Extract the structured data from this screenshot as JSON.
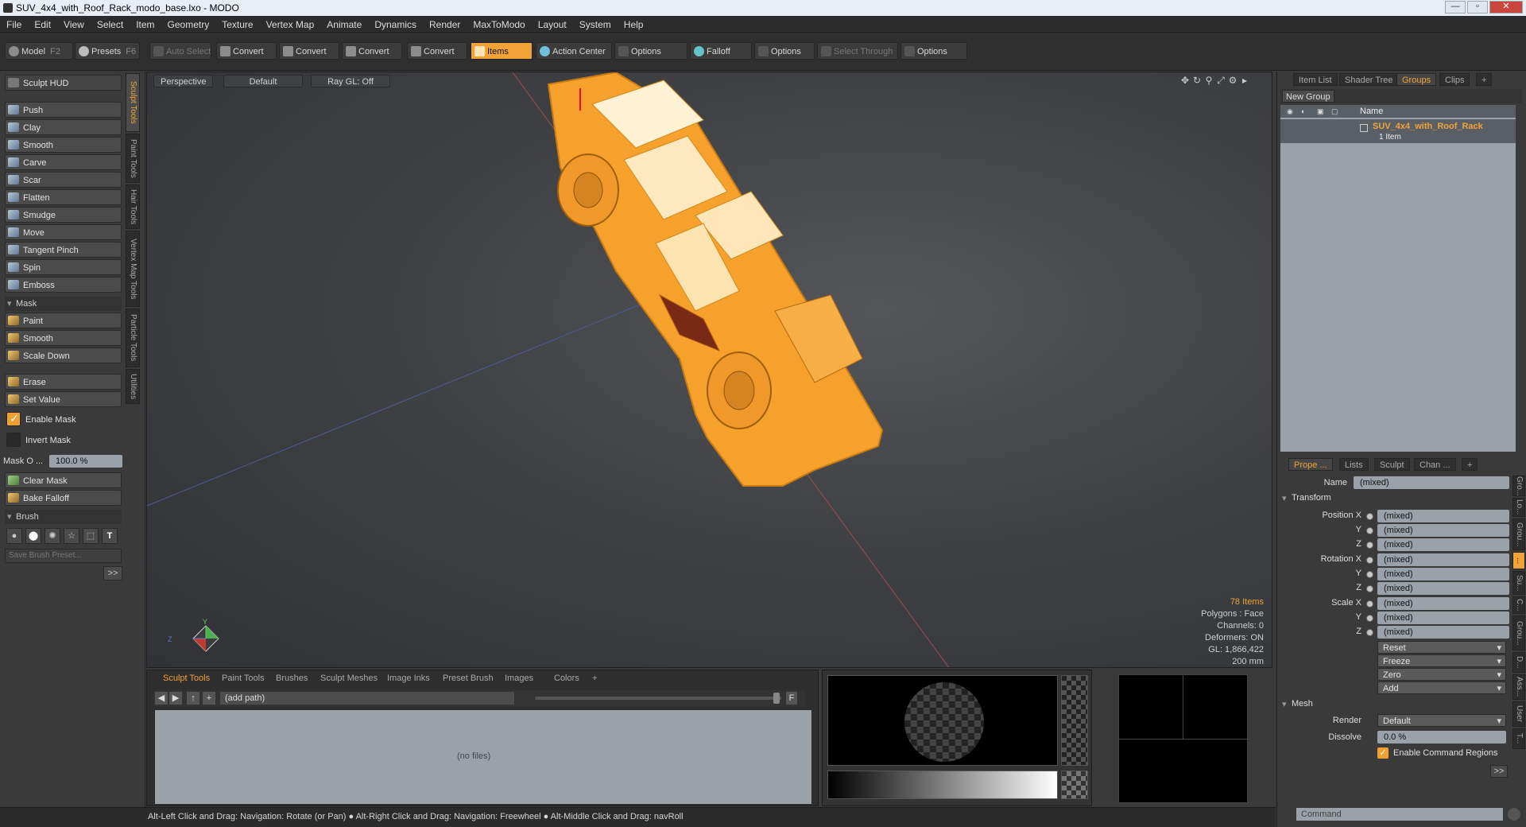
{
  "window": {
    "title": "SUV_4x4_with_Roof_Rack_modo_base.lxo - MODO",
    "min": "—",
    "max": "▫",
    "close": "✕"
  },
  "menu": [
    "File",
    "Edit",
    "View",
    "Select",
    "Item",
    "Geometry",
    "Texture",
    "Vertex Map",
    "Animate",
    "Dynamics",
    "Render",
    "MaxToModo",
    "Layout",
    "System",
    "Help"
  ],
  "toolbar": {
    "model": "Model",
    "model_key": "F2",
    "presets": "Presets",
    "presets_key": "F6",
    "auto_select": "Auto Select",
    "convert1": "Convert",
    "convert2": "Convert",
    "convert3": "Convert",
    "convert4": "Convert",
    "items": "Items",
    "action_center": "Action Center",
    "options1": "Options",
    "falloff": "Falloff",
    "options2": "Options",
    "select_through": "Select Through",
    "options3": "Options"
  },
  "left": {
    "hud": "Sculpt HUD",
    "tools": [
      "Push",
      "Clay",
      "Smooth",
      "Carve",
      "Scar",
      "Flatten",
      "Smudge",
      "Move",
      "Tangent Pinch",
      "Spin",
      "Emboss"
    ],
    "mask_section": "Mask",
    "mask_tools": [
      "Paint",
      "Smooth",
      "Scale Down"
    ],
    "erase": "Erase",
    "set_value": "Set Value",
    "enable_mask": "Enable Mask",
    "invert_mask": "Invert Mask",
    "mask_opacity_label": "Mask O ...",
    "mask_opacity_value": "100.0 %",
    "clear_mask": "Clear Mask",
    "bake_falloff": "Bake Falloff",
    "brush_section": "Brush",
    "save_brush_placeholder": "Save Brush Preset...",
    "more": ">>"
  },
  "vtabs": [
    "Sculpt Tools",
    "Paint Tools",
    "Hair Tools",
    "Vertex Map Tools",
    "Particle Tools",
    "Utilities"
  ],
  "viewport": {
    "view": "Perspective",
    "shading": "Default",
    "raygl": "Ray GL: Off",
    "stats": {
      "items": "78 Items",
      "polygons": "Polygons : Face",
      "channels": "Channels: 0",
      "deformers": "Deformers: ON",
      "gl": "GL: 1,866,422",
      "scale": "200 mm"
    },
    "axis_y": "Y",
    "axis_z": "Z"
  },
  "bottom": {
    "tabs": [
      "Sculpt Tools",
      "Paint Tools",
      "Brushes",
      "Sculpt Meshes",
      "Image Inks",
      "Preset Brush",
      "Images",
      "Colors",
      "+"
    ],
    "path": "(add path)",
    "no_files": "(no files)",
    "f": "F"
  },
  "right": {
    "tabs": [
      "Item List",
      "Shader Tree",
      "Groups",
      "Clips",
      "+"
    ],
    "new_group": "New Group",
    "name_col": "Name",
    "group_name": "SUV_4x4_with_Roof_Rack",
    "group_count": "1 Item",
    "prop_tabs": [
      "Prope ...",
      "Lists",
      "Sculpt",
      "Chan ...",
      "+"
    ],
    "name_label": "Name",
    "name_value": "(mixed)",
    "transform": "Transform",
    "rows": [
      {
        "label": "Position X",
        "value": "(mixed)"
      },
      {
        "label": "Y",
        "value": "(mixed)"
      },
      {
        "label": "Z",
        "value": "(mixed)"
      },
      {
        "label": "Rotation X",
        "value": "(mixed)"
      },
      {
        "label": "Y",
        "value": "(mixed)"
      },
      {
        "label": "Z",
        "value": "(mixed)"
      },
      {
        "label": "Scale X",
        "value": "(mixed)"
      },
      {
        "label": "Y",
        "value": "(mixed)"
      },
      {
        "label": "Z",
        "value": "(mixed)"
      }
    ],
    "drops": [
      "Reset",
      "Freeze",
      "Zero",
      "Add"
    ],
    "mesh": "Mesh",
    "render_label": "Render",
    "render_value": "Default",
    "dissolve_label": "Dissolve",
    "dissolve_value": "0.0 %",
    "enable_cmd": "Enable Command Regions",
    "more": ">>",
    "side_tabs": [
      "Gro...",
      "Lo...",
      "Grou...",
      "...",
      "Su...",
      "C...",
      "Grou...",
      "D...",
      "Ass...",
      "User",
      "T..."
    ],
    "command_placeholder": "Command"
  },
  "status": "Alt-Left Click and Drag: Navigation: Rotate (or Pan) ● Alt-Right Click and Drag: Navigation: Freewheel ● Alt-Middle Click and Drag: navRoll",
  "colors": {
    "accent": "#f1a33a",
    "wire": "#f5a12c"
  }
}
